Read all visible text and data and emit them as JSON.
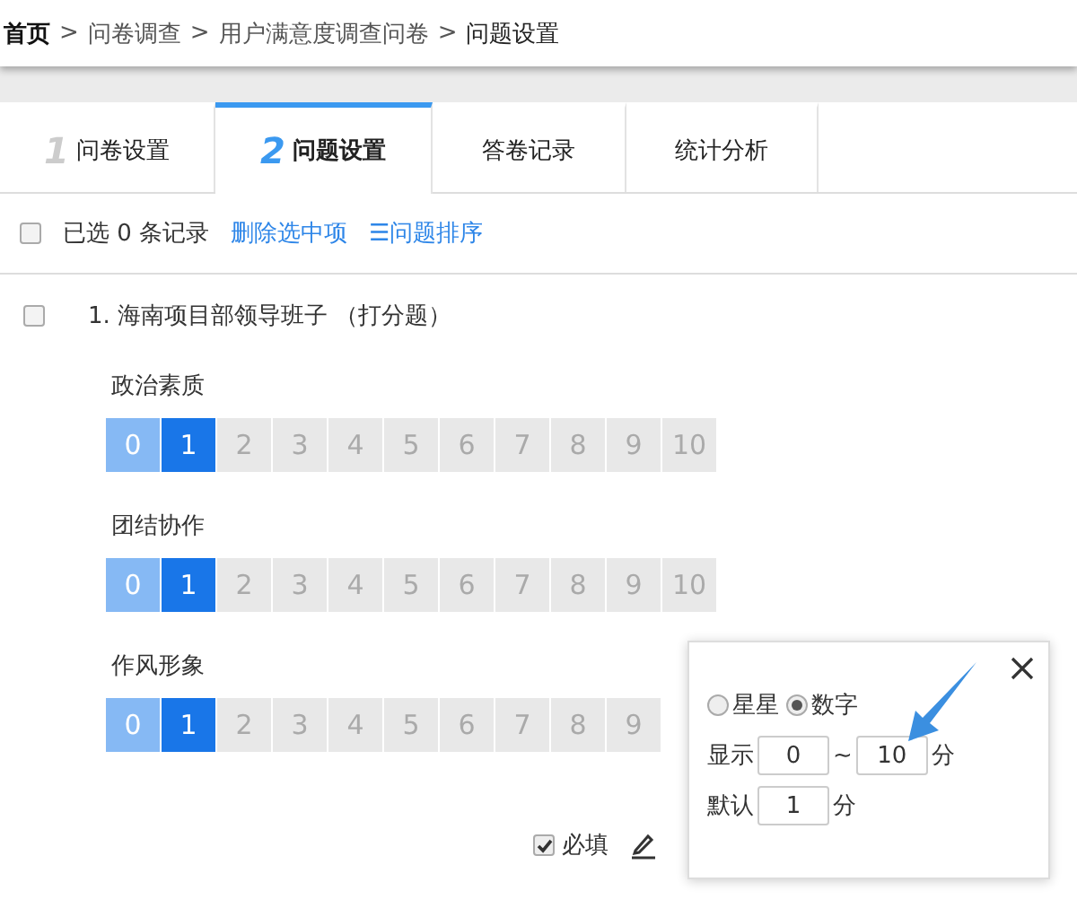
{
  "breadcrumb": [
    {
      "label": "首页",
      "kind": "home"
    },
    {
      "label": ">",
      "kind": "separator"
    },
    {
      "label": "问卷调查",
      "kind": "link"
    },
    {
      "label": ">",
      "kind": "separator"
    },
    {
      "label": "用户满意度调查问卷",
      "kind": "link"
    },
    {
      "label": ">",
      "kind": "separator"
    },
    {
      "label": "问题设置",
      "kind": "current"
    }
  ],
  "tabs": [
    {
      "number": "1",
      "label": "问卷设置",
      "selected": false
    },
    {
      "number": "2",
      "label": "问题设置",
      "selected": true
    },
    {
      "label": "答卷记录",
      "selected": false
    },
    {
      "label": "统计分析",
      "selected": false
    }
  ],
  "toolbar": {
    "checked": false,
    "count_text": "已选 0 条记录",
    "delete_link": "删除选中项",
    "sort_icon": "☰",
    "sort_link": "问题排序"
  },
  "question": {
    "checked": false,
    "title": "1. 海南项目部领导班子 （打分题）",
    "criteria": [
      {
        "label": "政治素质",
        "scores": [
          {
            "label": "0",
            "kind": "passed"
          },
          {
            "label": "1",
            "kind": "chosen"
          },
          {
            "label": "2",
            "kind": "empty"
          },
          {
            "label": "3",
            "kind": "empty"
          },
          {
            "label": "4",
            "kind": "empty"
          },
          {
            "label": "5",
            "kind": "empty"
          },
          {
            "label": "6",
            "kind": "empty"
          },
          {
            "label": "7",
            "kind": "empty"
          },
          {
            "label": "8",
            "kind": "empty"
          },
          {
            "label": "9",
            "kind": "empty"
          },
          {
            "label": "10",
            "kind": "empty"
          }
        ]
      },
      {
        "label": "团结协作",
        "scores": [
          {
            "label": "0",
            "kind": "passed"
          },
          {
            "label": "1",
            "kind": "chosen"
          },
          {
            "label": "2",
            "kind": "empty"
          },
          {
            "label": "3",
            "kind": "empty"
          },
          {
            "label": "4",
            "kind": "empty"
          },
          {
            "label": "5",
            "kind": "empty"
          },
          {
            "label": "6",
            "kind": "empty"
          },
          {
            "label": "7",
            "kind": "empty"
          },
          {
            "label": "8",
            "kind": "empty"
          },
          {
            "label": "9",
            "kind": "empty"
          },
          {
            "label": "10",
            "kind": "empty"
          }
        ]
      },
      {
        "label": "作风形象",
        "scores": [
          {
            "label": "0",
            "kind": "passed"
          },
          {
            "label": "1",
            "kind": "chosen"
          },
          {
            "label": "2",
            "kind": "empty"
          },
          {
            "label": "3",
            "kind": "empty"
          },
          {
            "label": "4",
            "kind": "empty"
          },
          {
            "label": "5",
            "kind": "empty"
          },
          {
            "label": "6",
            "kind": "empty"
          },
          {
            "label": "7",
            "kind": "empty"
          },
          {
            "label": "8",
            "kind": "empty"
          },
          {
            "label": "9",
            "kind": "empty"
          }
        ]
      }
    ],
    "required": {
      "label": "必填",
      "checked": true
    }
  },
  "popup": {
    "styles": [
      {
        "label": "星星",
        "selected": false
      },
      {
        "label": "数字",
        "selected": true
      }
    ],
    "range_label": "显示",
    "min": "0",
    "tilde": "~",
    "max": "10",
    "unit": "分",
    "default_label": "默认",
    "default": "1",
    "default_unit": "分"
  }
}
